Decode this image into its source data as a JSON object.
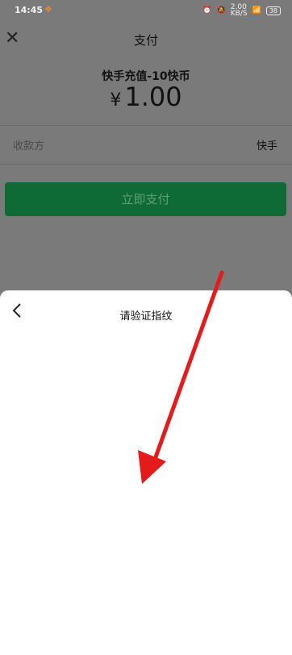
{
  "status_bar": {
    "time": "14:45",
    "network_speed": "2.00\nKB/S",
    "battery": "38"
  },
  "nav": {
    "title": "支付"
  },
  "payment": {
    "product": "快手充值-10快币",
    "currency_symbol": "¥",
    "amount": "1.00",
    "payee_label": "收款方",
    "payee_value": "快手",
    "pay_button_label": "立即支付",
    "button_color": "#0f6b35"
  },
  "sheet": {
    "title": "请验证指纹"
  },
  "annotation": {
    "arrow_color": "#e31b1b"
  }
}
